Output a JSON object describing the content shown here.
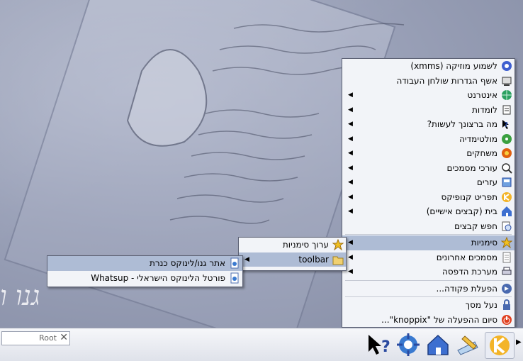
{
  "main_menu": {
    "items": [
      {
        "label": "לשמוע מוזיקה (xmms)",
        "icon": "music-icon",
        "submenu": false,
        "highlighted": false
      },
      {
        "label": "אשף הגדרות שולחן העבודה",
        "icon": "desktop-wizard-icon",
        "submenu": false,
        "highlighted": false
      },
      {
        "label": "אינטרנט",
        "icon": "globe-icon",
        "submenu": true,
        "highlighted": false
      },
      {
        "label": "לומדות",
        "icon": "edutainment-icon",
        "submenu": true,
        "highlighted": false
      },
      {
        "label": "מה ברצונך לעשות?",
        "icon": "help-arrow-icon",
        "submenu": true,
        "highlighted": false
      },
      {
        "label": "מולטימדיה",
        "icon": "multimedia-icon",
        "submenu": true,
        "highlighted": false
      },
      {
        "label": "משחקים",
        "icon": "games-icon",
        "submenu": true,
        "highlighted": false
      },
      {
        "label": "עורכי מסמכים",
        "icon": "magnifier-icon",
        "submenu": true,
        "highlighted": false
      },
      {
        "label": "עזרים",
        "icon": "utilities-icon",
        "submenu": true,
        "highlighted": false
      },
      {
        "label": "תפריט קנופיקס",
        "icon": "knoppix-icon",
        "submenu": true,
        "highlighted": false
      },
      {
        "label": "בית (קבצים אישיים)",
        "icon": "home-icon",
        "submenu": true,
        "highlighted": false
      },
      {
        "label": "חפש קבצים",
        "icon": "find-files-icon",
        "submenu": false,
        "highlighted": false
      },
      {
        "separator": true
      },
      {
        "label": "סימניות",
        "icon": "bookmarks-star-icon",
        "submenu": true,
        "highlighted": true
      },
      {
        "label": "מסמכים אחרונים",
        "icon": "recent-documents-icon",
        "submenu": true,
        "highlighted": false
      },
      {
        "label": "מערכת הדפסה",
        "icon": "printer-icon",
        "submenu": true,
        "highlighted": false
      },
      {
        "separator": true
      },
      {
        "label": "הפעלת פקודה...",
        "icon": "run-command-icon",
        "submenu": false,
        "highlighted": false
      },
      {
        "separator": true
      },
      {
        "label": "נעל מסך",
        "icon": "lock-icon",
        "submenu": false,
        "highlighted": false
      },
      {
        "label": "סיום ההפעלה של \"knoppix\"...",
        "icon": "logout-icon",
        "submenu": false,
        "highlighted": false
      }
    ]
  },
  "bookmarks_menu": {
    "items": [
      {
        "label": "ערוך סימניות",
        "icon": "edit-bookmarks-star-icon",
        "submenu": false,
        "highlighted": false
      },
      {
        "label": "toolbar",
        "icon": "toolbar-folder-icon",
        "submenu": true,
        "highlighted": true
      }
    ]
  },
  "toolbar_menu": {
    "items": [
      {
        "label": "אתר גנו/לינוקס כנרת",
        "icon": "web-page-icon",
        "submenu": false,
        "highlighted": true
      },
      {
        "label": "פורטל הלינוקס הישראלי - Whatsup",
        "icon": "web-page-icon",
        "submenu": false,
        "highlighted": false
      }
    ]
  },
  "taskbar": {
    "pager_label": "Root",
    "icons": [
      "help-icon",
      "network-icon",
      "home-folder-icon",
      "editor-icon",
      "kmenu-icon"
    ]
  },
  "desktop_text": "גנו ו",
  "colors": {
    "highlight": "#aebcd5",
    "menu_bg": "#f2f4f8",
    "desktop": "#9aa1b8"
  }
}
